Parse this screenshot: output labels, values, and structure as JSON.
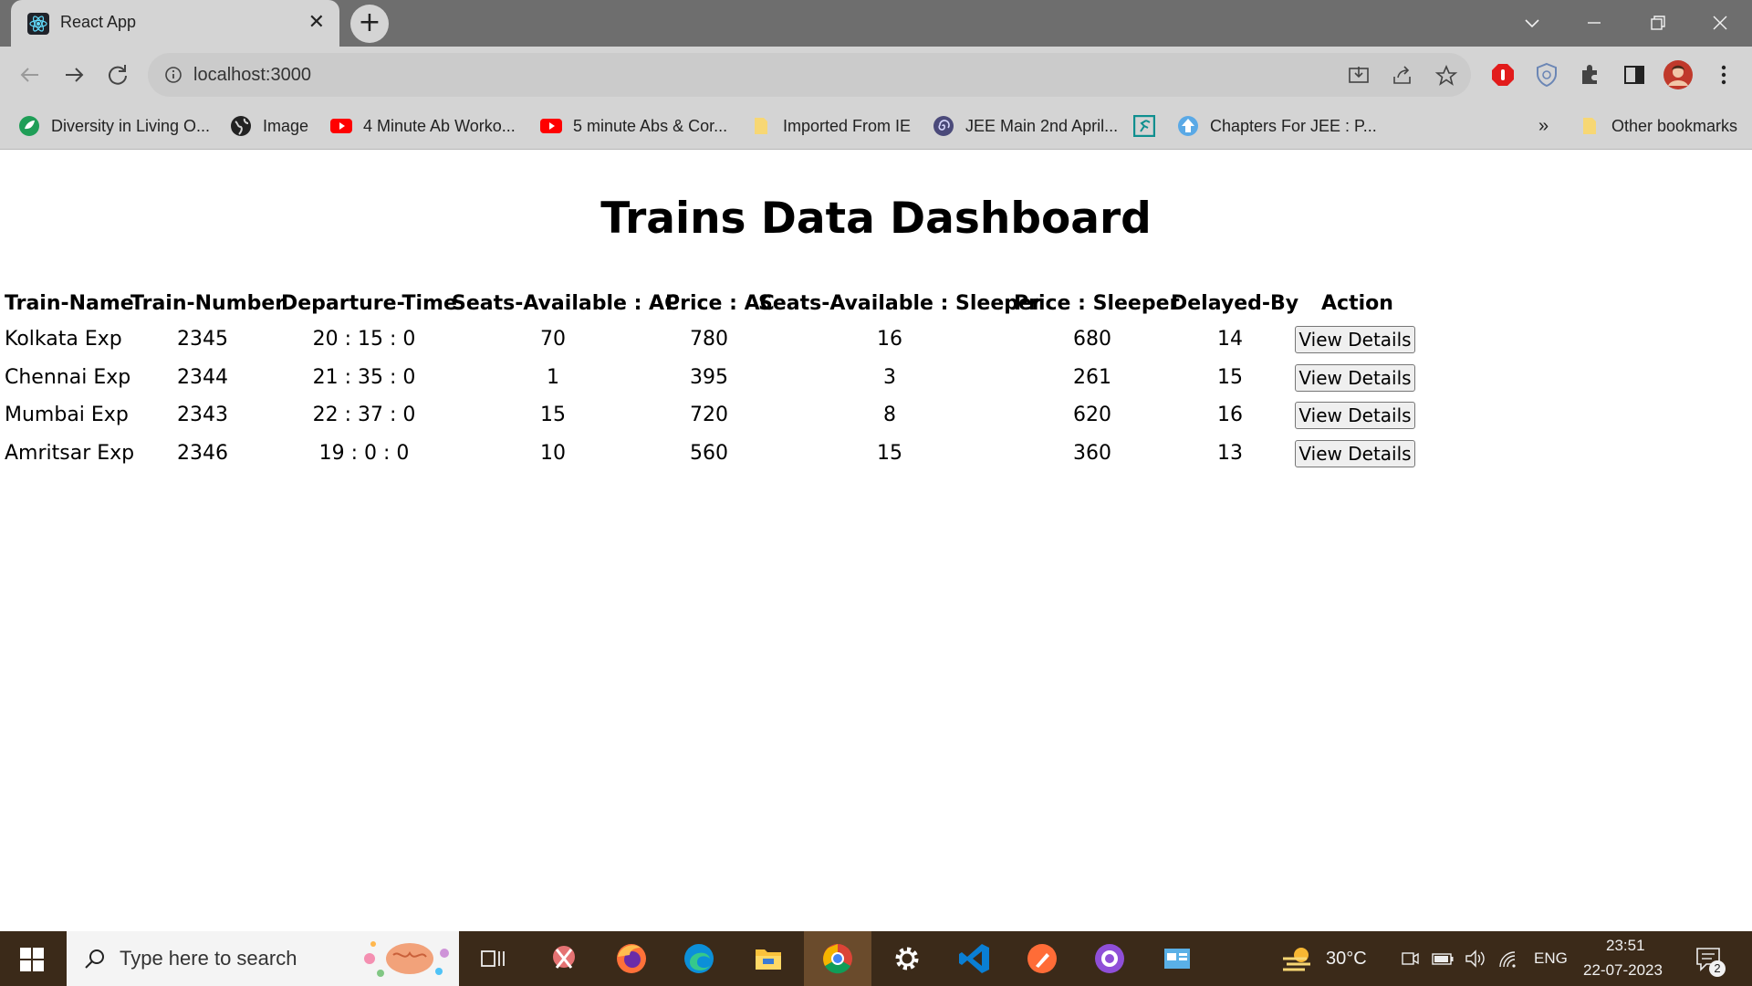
{
  "browser": {
    "tab_title": "React App",
    "tab_close": "✕",
    "new_tab": "+",
    "url": "localhost:3000",
    "bookmarks": [
      "Diversity in Living O...",
      "Image",
      "4 Minute Ab Worko...",
      "5 minute Abs & Cor...",
      "Imported From IE",
      "JEE Main 2nd April...",
      "Chapters For JEE : P..."
    ],
    "bookmarks_overflow": "»",
    "other_bookmarks": "Other bookmarks"
  },
  "dashboard": {
    "title": "Trains Data Dashboard",
    "headers": [
      "Train-Name",
      "Train-Number",
      "Departure-Time",
      "Seats-Available : AC",
      "Price : AC",
      "Seats-Available : Sleeper",
      "Price : Sleeper",
      "Delayed-By",
      "Action"
    ],
    "rows": [
      {
        "name": "Kolkata Exp",
        "number": "2345",
        "departure": "20 : 15 : 0",
        "seats_ac": "70",
        "price_ac": "780",
        "seats_sleeper": "16",
        "price_sleeper": "680",
        "delayed_by": "14",
        "action": "View Details"
      },
      {
        "name": "Chennai Exp",
        "number": "2344",
        "departure": "21 : 35 : 0",
        "seats_ac": "1",
        "price_ac": "395",
        "seats_sleeper": "3",
        "price_sleeper": "261",
        "delayed_by": "15",
        "action": "View Details"
      },
      {
        "name": "Mumbai Exp",
        "number": "2343",
        "departure": "22 : 37 : 0",
        "seats_ac": "15",
        "price_ac": "720",
        "seats_sleeper": "8",
        "price_sleeper": "620",
        "delayed_by": "16",
        "action": "View Details"
      },
      {
        "name": "Amritsar Exp",
        "number": "2346",
        "departure": "19 : 0 : 0",
        "seats_ac": "10",
        "price_ac": "560",
        "seats_sleeper": "15",
        "price_sleeper": "360",
        "delayed_by": "13",
        "action": "View Details"
      }
    ]
  },
  "taskbar": {
    "search_placeholder": "Type here to search",
    "temperature": "30°C",
    "language": "ENG",
    "time": "23:51",
    "date": "22-07-2023",
    "notification_count": "2"
  }
}
